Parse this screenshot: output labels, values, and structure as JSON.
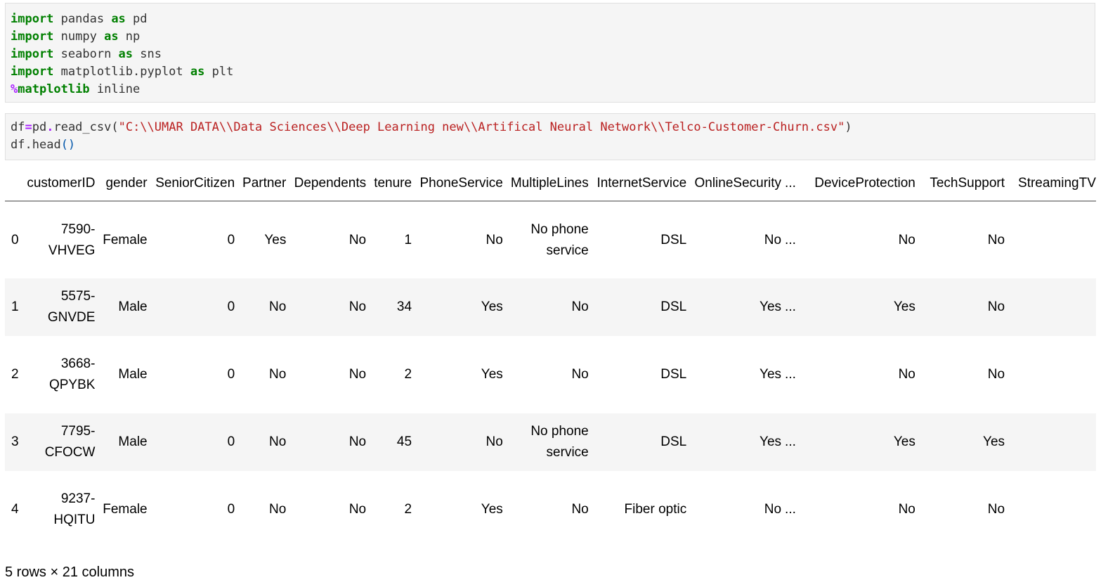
{
  "cell1": {
    "lines": [
      {
        "kw1": "import",
        "mod": " pandas ",
        "kw2": "as",
        "alias": " pd"
      },
      {
        "kw1": "import",
        "mod": " numpy ",
        "kw2": "as",
        "alias": " np"
      },
      {
        "kw1": "import",
        "mod": " seaborn ",
        "kw2": "as",
        "alias": " sns"
      },
      {
        "kw1": "import",
        "mod": " matplotlib.pyplot ",
        "kw2": "as",
        "alias": " plt"
      }
    ],
    "magic_pct": "%",
    "magic_name": "matplotlib",
    "magic_arg": " inline"
  },
  "cell2": {
    "var": "df",
    "eq": "=",
    "call": "pd",
    "dot": ".",
    "func": "read_csv(",
    "path": "\"C:\\\\UMAR DATA\\\\Data Sciences\\\\Deep Learning new\\\\Artifical Neural Network\\\\Telco-Customer-Churn.csv\"",
    "close": ")",
    "line2_obj": "df",
    "line2_dot": ".",
    "line2_func": "head",
    "line2_parens": "()"
  },
  "table": {
    "columns": [
      "customerID",
      "gender",
      "SeniorCitizen",
      "Partner",
      "Dependents",
      "tenure",
      "PhoneService",
      "MultipleLines",
      "InternetService",
      "OnlineSecurity",
      "...",
      "DeviceProtection",
      "TechSupport",
      "StreamingTV"
    ],
    "rows": [
      {
        "index": "0",
        "cells": [
          "7590-VHVEG",
          "Female",
          "0",
          "Yes",
          "No",
          "1",
          "No",
          "No phone service",
          "DSL",
          "No",
          "...",
          "No",
          "No",
          ""
        ]
      },
      {
        "index": "1",
        "cells": [
          "5575-GNVDE",
          "Male",
          "0",
          "No",
          "No",
          "34",
          "Yes",
          "No",
          "DSL",
          "Yes",
          "...",
          "Yes",
          "No",
          ""
        ]
      },
      {
        "index": "2",
        "cells": [
          "3668-QPYBK",
          "Male",
          "0",
          "No",
          "No",
          "2",
          "Yes",
          "No",
          "DSL",
          "Yes",
          "...",
          "No",
          "No",
          ""
        ]
      },
      {
        "index": "3",
        "cells": [
          "7795-CFOCW",
          "Male",
          "0",
          "No",
          "No",
          "45",
          "No",
          "No phone service",
          "DSL",
          "Yes",
          "...",
          "Yes",
          "Yes",
          ""
        ]
      },
      {
        "index": "4",
        "cells": [
          "9237-HQITU",
          "Female",
          "0",
          "No",
          "No",
          "2",
          "Yes",
          "No",
          "Fiber optic",
          "No",
          "...",
          "No",
          "No",
          ""
        ]
      }
    ]
  },
  "shape_info": "5 rows × 21 columns"
}
